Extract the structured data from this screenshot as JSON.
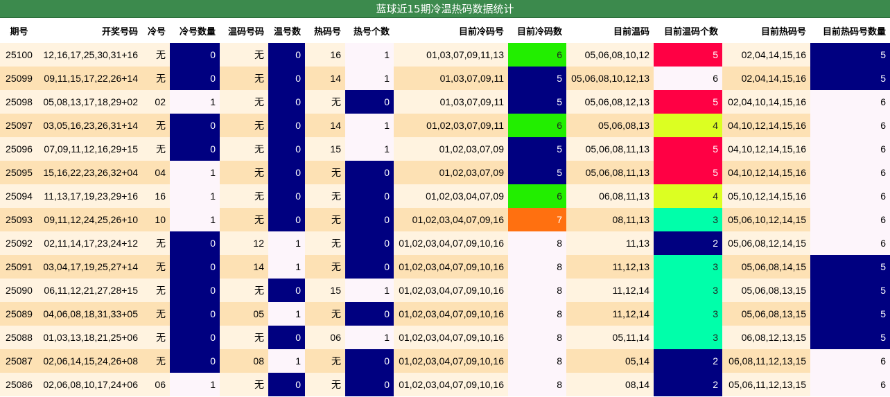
{
  "title": "蓝球近15期冷温热码数据统计",
  "headers": [
    "期号",
    "开奖号码",
    "冷号",
    "冷号数量",
    "温码号码",
    "温号数",
    "热码号",
    "热号个数",
    "目前冷码号",
    "目前冷码数",
    "目前温码",
    "目前温码个数",
    "目前热码号",
    "目前热码号数量"
  ],
  "colors": {
    "navy": "#000080",
    "white": "#fdf5fb",
    "green": "#22ee00",
    "orange": "#ff7010",
    "red": "#ff0044",
    "yellowgreen": "#dcff22",
    "mint": "#00ffaa"
  },
  "rows": [
    {
      "cells": [
        "25100",
        "12,16,17,25,30,31+16",
        "无",
        "0",
        "无",
        "0",
        "16",
        "1",
        "01,03,07,09,11,13",
        "6",
        "05,06,08,10,12",
        "5",
        "02,04,14,15,16",
        "5"
      ],
      "hl": {
        "3": "navy",
        "5": "navy",
        "7": "white",
        "9": "green",
        "11": "red",
        "13": "navy"
      }
    },
    {
      "cells": [
        "25099",
        "09,11,15,17,22,26+14",
        "无",
        "0",
        "无",
        "0",
        "14",
        "1",
        "01,03,07,09,11",
        "5",
        "05,06,08,10,12,13",
        "6",
        "02,04,14,15,16",
        "5"
      ],
      "hl": {
        "3": "navy",
        "5": "navy",
        "7": "white",
        "9": "navy",
        "11": "white",
        "13": "navy"
      }
    },
    {
      "cells": [
        "25098",
        "05,08,13,17,18,29+02",
        "02",
        "1",
        "无",
        "0",
        "无",
        "0",
        "01,03,07,09,11",
        "5",
        "05,06,08,12,13",
        "5",
        "02,04,10,14,15,16",
        "6"
      ],
      "hl": {
        "3": "white",
        "5": "navy",
        "7": "navy",
        "9": "navy",
        "11": "red",
        "13": "white"
      }
    },
    {
      "cells": [
        "25097",
        "03,05,16,23,26,31+14",
        "无",
        "0",
        "无",
        "0",
        "14",
        "1",
        "01,02,03,07,09,11",
        "6",
        "05,06,08,13",
        "4",
        "04,10,12,14,15,16",
        "6"
      ],
      "hl": {
        "3": "navy",
        "5": "navy",
        "7": "white",
        "9": "green",
        "11": "yellowgreen",
        "13": "white"
      }
    },
    {
      "cells": [
        "25096",
        "07,09,11,12,16,29+15",
        "无",
        "0",
        "无",
        "0",
        "15",
        "1",
        "01,02,03,07,09",
        "5",
        "05,06,08,11,13",
        "5",
        "04,10,12,14,15,16",
        "6"
      ],
      "hl": {
        "3": "navy",
        "5": "navy",
        "7": "white",
        "9": "navy",
        "11": "red",
        "13": "white"
      }
    },
    {
      "cells": [
        "25095",
        "15,16,22,23,26,32+04",
        "04",
        "1",
        "无",
        "0",
        "无",
        "0",
        "01,02,03,07,09",
        "5",
        "05,06,08,11,13",
        "5",
        "04,10,12,14,15,16",
        "6"
      ],
      "hl": {
        "3": "white",
        "5": "navy",
        "7": "navy",
        "9": "navy",
        "11": "red",
        "13": "white"
      }
    },
    {
      "cells": [
        "25094",
        "11,13,17,19,23,29+16",
        "16",
        "1",
        "无",
        "0",
        "无",
        "0",
        "01,02,03,04,07,09",
        "6",
        "06,08,11,13",
        "4",
        "05,10,12,14,15,16",
        "6"
      ],
      "hl": {
        "3": "white",
        "5": "navy",
        "7": "navy",
        "9": "green",
        "11": "yellowgreen",
        "13": "white"
      }
    },
    {
      "cells": [
        "25093",
        "09,11,12,24,25,26+10",
        "10",
        "1",
        "无",
        "0",
        "无",
        "0",
        "01,02,03,04,07,09,16",
        "7",
        "08,11,13",
        "3",
        "05,06,10,12,14,15",
        "6"
      ],
      "hl": {
        "3": "white",
        "5": "navy",
        "7": "navy",
        "9": "orange",
        "11": "mint",
        "13": "white"
      }
    },
    {
      "cells": [
        "25092",
        "02,11,14,17,23,24+12",
        "无",
        "0",
        "12",
        "1",
        "无",
        "0",
        "01,02,03,04,07,09,10,16",
        "8",
        "11,13",
        "2",
        "05,06,08,12,14,15",
        "6"
      ],
      "hl": {
        "3": "navy",
        "5": "white",
        "7": "navy",
        "9": "white",
        "11": "navy",
        "13": "white"
      }
    },
    {
      "cells": [
        "25091",
        "03,04,17,19,25,27+14",
        "无",
        "0",
        "14",
        "1",
        "无",
        "0",
        "01,02,03,04,07,09,10,16",
        "8",
        "11,12,13",
        "3",
        "05,06,08,14,15",
        "5"
      ],
      "hl": {
        "3": "navy",
        "5": "white",
        "7": "navy",
        "9": "white",
        "11": "mint",
        "13": "navy"
      }
    },
    {
      "cells": [
        "25090",
        "06,11,12,21,27,28+15",
        "无",
        "0",
        "无",
        "0",
        "15",
        "1",
        "01,02,03,04,07,09,10,16",
        "8",
        "11,12,14",
        "3",
        "05,06,08,13,15",
        "5"
      ],
      "hl": {
        "3": "navy",
        "5": "navy",
        "7": "white",
        "9": "white",
        "11": "mint",
        "13": "navy"
      }
    },
    {
      "cells": [
        "25089",
        "04,06,08,18,31,33+05",
        "无",
        "0",
        "05",
        "1",
        "无",
        "0",
        "01,02,03,04,07,09,10,16",
        "8",
        "11,12,14",
        "3",
        "05,06,08,13,15",
        "5"
      ],
      "hl": {
        "3": "navy",
        "5": "white",
        "7": "navy",
        "9": "white",
        "11": "mint",
        "13": "navy"
      }
    },
    {
      "cells": [
        "25088",
        "01,03,13,18,21,25+06",
        "无",
        "0",
        "无",
        "0",
        "06",
        "1",
        "01,02,03,04,07,09,10,16",
        "8",
        "05,11,14",
        "3",
        "06,08,12,13,15",
        "5"
      ],
      "hl": {
        "3": "navy",
        "5": "navy",
        "7": "white",
        "9": "white",
        "11": "mint",
        "13": "navy"
      }
    },
    {
      "cells": [
        "25087",
        "02,06,14,15,24,26+08",
        "无",
        "0",
        "08",
        "1",
        "无",
        "0",
        "01,02,03,04,07,09,10,16",
        "8",
        "05,14",
        "2",
        "06,08,11,12,13,15",
        "6"
      ],
      "hl": {
        "3": "navy",
        "5": "white",
        "7": "navy",
        "9": "white",
        "11": "navy",
        "13": "white"
      }
    },
    {
      "cells": [
        "25086",
        "02,06,08,10,17,24+06",
        "06",
        "1",
        "无",
        "0",
        "无",
        "0",
        "01,02,03,04,07,09,10,16",
        "8",
        "08,14",
        "2",
        "05,06,11,12,13,15",
        "6"
      ],
      "hl": {
        "3": "white",
        "5": "navy",
        "7": "navy",
        "9": "white",
        "11": "navy",
        "13": "white"
      }
    }
  ]
}
